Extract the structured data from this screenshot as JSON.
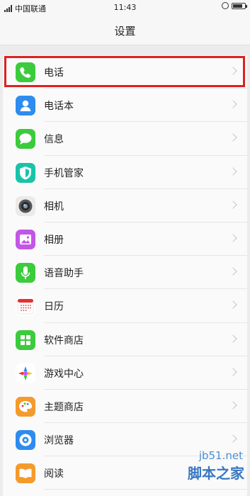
{
  "status_bar": {
    "carrier": "中国联通",
    "time": "11:43",
    "battery_level": 0.8
  },
  "header": {
    "title": "设置"
  },
  "settings_items": [
    {
      "label": "电话",
      "icon": "phone-icon",
      "color": "#3ccb3c",
      "highlighted": true
    },
    {
      "label": "电话本",
      "icon": "contacts-icon",
      "color": "#2d8cf0"
    },
    {
      "label": "信息",
      "icon": "messages-icon",
      "color": "#3ccb3c"
    },
    {
      "label": "手机管家",
      "icon": "shield-icon",
      "color": "#19c3a8"
    },
    {
      "label": "相机",
      "icon": "camera-icon",
      "color": "#8d8d8d"
    },
    {
      "label": "相册",
      "icon": "gallery-icon",
      "color": "#c256e6"
    },
    {
      "label": "语音助手",
      "icon": "microphone-icon",
      "color": "#3ccb3c"
    },
    {
      "label": "日历",
      "icon": "calendar-icon",
      "color": "#e63030"
    },
    {
      "label": "软件商店",
      "icon": "app-store-icon",
      "color": "#3ccb3c"
    },
    {
      "label": "游戏中心",
      "icon": "game-center-icon",
      "color": "#f25a8a"
    },
    {
      "label": "主题商店",
      "icon": "palette-icon",
      "color": "#f59a2c"
    },
    {
      "label": "浏览器",
      "icon": "browser-icon",
      "color": "#2d8cf0"
    },
    {
      "label": "阅读",
      "icon": "book-icon",
      "color": "#f59a2c"
    }
  ],
  "watermark": {
    "url": "jb51.net",
    "name": "脚本之家"
  }
}
